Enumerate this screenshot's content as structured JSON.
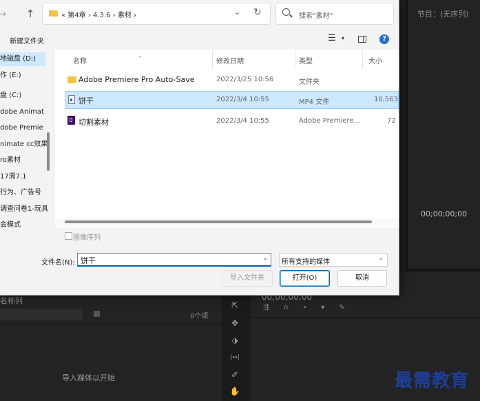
{
  "premiere": {
    "program_monitor_title": "节目：(无序列)",
    "program_timecode": "00;00;00;00",
    "project_panel_name": "名称列",
    "project_item_count": "0个项",
    "project_hint": "导入媒体以开始",
    "timeline_timecode": "00;00;00;00",
    "timeline_icons": "⇶ ∩ ⁌ ▾ ✎",
    "tools": [
      "⇱",
      "✥",
      "⬗",
      "|↔|",
      "✐",
      "✋"
    ]
  },
  "watermark": "最需教育",
  "dialog": {
    "nav": {
      "back": "←",
      "forward": "→",
      "up": "↑"
    },
    "address": {
      "path": "«  第4章  ›  4.3.6  ›  素材  ›",
      "dropdown": "⌄",
      "refresh": "↻"
    },
    "search": {
      "placeholder": "搜索\"素材\""
    },
    "toolbar": {
      "new_folder": "新建文件夹",
      "view": "☰",
      "view_drop": "▾",
      "help": "?"
    },
    "sidebar": {
      "items": [
        {
          "label": "地磁盘 (D:)",
          "selected": true
        },
        {
          "label": "作 (E:)"
        },
        {
          "label": "盘 (C:)"
        },
        {
          "label": "dobe Animat"
        },
        {
          "label": "dobe Premie"
        },
        {
          "label": "nimate cc效果"
        },
        {
          "label": "ro素材"
        },
        {
          "label": "17周7.1"
        },
        {
          "label": "行为、广告号"
        },
        {
          "label": "调查问卷1-玩具"
        },
        {
          "label": "会模式"
        }
      ]
    },
    "columns": {
      "name": "名称",
      "modified": "修改日期",
      "type": "类型",
      "size": "大小"
    },
    "files": [
      {
        "name": "Adobe Premiere Pro Auto-Save",
        "modified": "2022/3/25 10:56",
        "type": "文件夹",
        "size": "",
        "icon": "folder-icon",
        "selected": false
      },
      {
        "name": "饼干",
        "modified": "2022/3/4 10:55",
        "type": "MP4 文件",
        "size": "10,563",
        "icon": "video-file-icon",
        "selected": true
      },
      {
        "name": "切割素材",
        "modified": "2022/3/4 10:55",
        "type": "Adobe Premiere...",
        "size": "72",
        "icon": "premiere-project-icon",
        "selected": false
      }
    ],
    "image_sequence_label": "图像序列",
    "filename": {
      "label": "文件名(N):",
      "value": "饼干",
      "dropdown": "⌄"
    },
    "filetype": {
      "value": "所有支持的媒体",
      "dropdown": "⌄"
    },
    "buttons": {
      "import_folder": "导入文件夹",
      "open": "打开(O)",
      "cancel": "取消"
    }
  }
}
